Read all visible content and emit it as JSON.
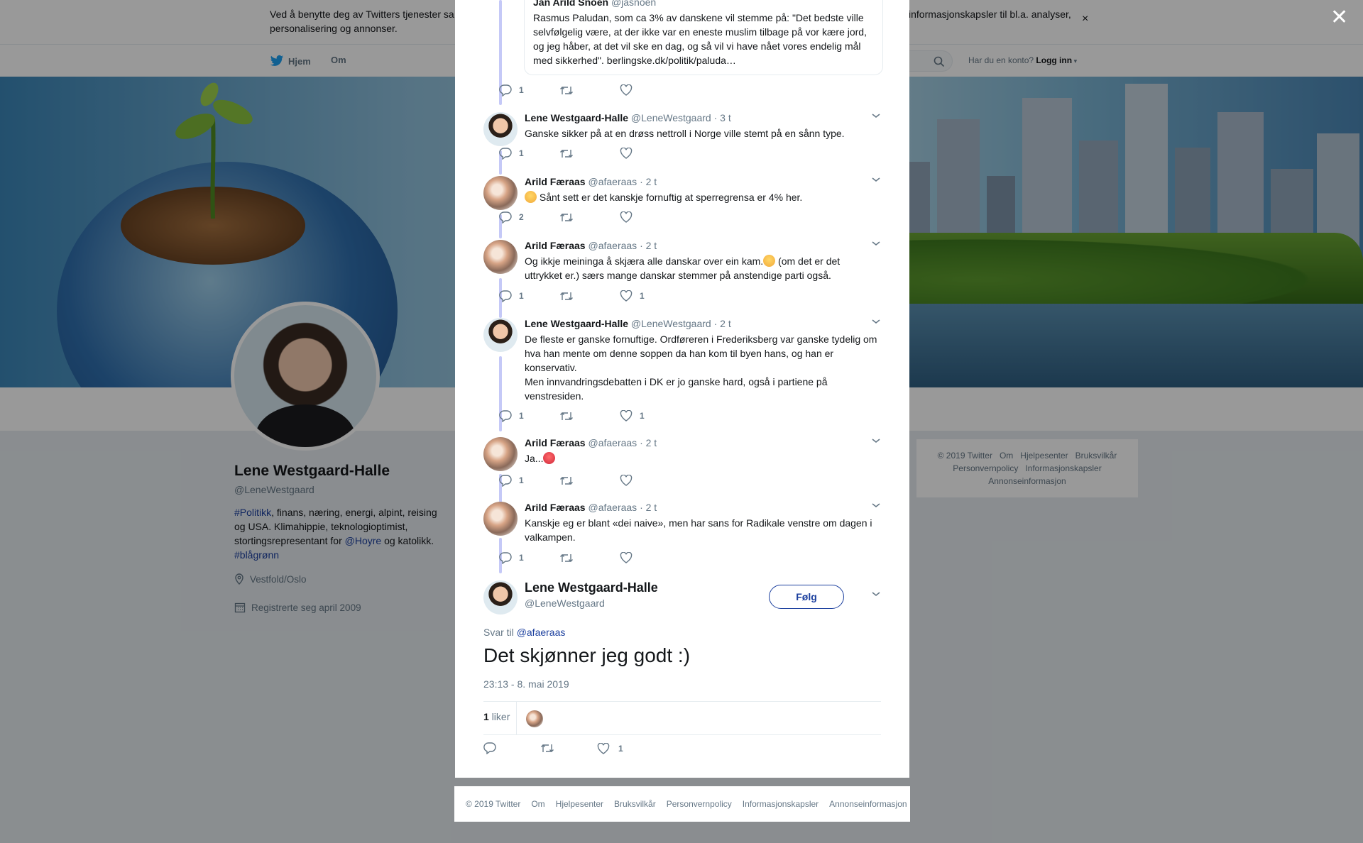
{
  "cookie_banner": {
    "text": "Ved å benytte deg av Twitters tjenester sa",
    "text_right": "informasjonskapsler til bl.a. analyser,",
    "text_line2": "personalisering og annonser.",
    "close": "×"
  },
  "topnav": {
    "home": "Hjem",
    "about": "Om",
    "have_account": "Har du en konto?",
    "login": "Logg inn"
  },
  "profile": {
    "name": "Lene Westgaard-Halle",
    "handle": "@LeneWestgaard",
    "bio_tag1": "#Politikk",
    "bio_text1": ", finans, næring, energi, alpint, reising og USA. Klimahippie, teknologioptimist, stortingsrepresentant for ",
    "bio_mention": "@Hoyre",
    "bio_text2": " og katolikk. ",
    "bio_tag2": "#blågrønn",
    "location": "Vestfold/Oslo",
    "joined": "Registrerte seg april 2009"
  },
  "side_footer": [
    "© 2019 Twitter",
    "Om",
    "Hjelpesenter",
    "Bruksvilkår",
    "Personvernpolicy",
    "Informasjonskapsler",
    "Annonseinformasjon"
  ],
  "modal": {
    "close": "✕",
    "quote": {
      "name": "Jan Arild Snoen",
      "handle": "@jasnoen",
      "text": "Rasmus Paludan, som ca 3% av danskene vil stemme på: \"Det bedste ville selvfølgelig være, at der ikke var en eneste muslim tilbage på vor kære jord, og jeg håber, at det vil ske en dag, og så vil vi have nået vores endelig mål med sikkerhed\". berlingske.dk/politik/paluda…",
      "replies": "1",
      "likes": ""
    },
    "tweets": [
      {
        "name": "Lene Westgaard-Halle",
        "handle": "@LeneWestgaard",
        "time": "· 3 t",
        "text": "Ganske sikker på at en drøss nettroll i Norge ville stemt på en sånn type.",
        "replies": "1",
        "likes": ""
      },
      {
        "name": "Arild Færaas",
        "handle": "@afaeraas",
        "time": "· 2 t",
        "text": "Sånt sett er det kanskje fornuftig at sperregrensa er 4% her.",
        "replies": "2",
        "likes": ""
      },
      {
        "name": "Arild Færaas",
        "handle": "@afaeraas",
        "time": "· 2 t",
        "text_a": "Og ikkje meininga å skjæra alle danskar over ein kam.",
        "text_b": " (om det er det uttrykket er.) særs mange danskar stemmer på anstendige parti også.",
        "replies": "1",
        "likes": "1"
      },
      {
        "name": "Lene Westgaard-Halle",
        "handle": "@LeneWestgaard",
        "time": "· 2 t",
        "text": "De fleste er ganske fornuftige. Ordføreren i Frederiksberg var ganske tydelig om hva han mente om denne soppen da han kom til byen hans, og han er konservativ.",
        "text2": "Men innvandringsdebatten i DK er jo ganske hard, også i partiene på venstresiden.",
        "replies": "1",
        "likes": "1"
      },
      {
        "name": "Arild Færaas",
        "handle": "@afaeraas",
        "time": "· 2 t",
        "text": "Ja...",
        "replies": "1",
        "likes": ""
      },
      {
        "name": "Arild Færaas",
        "handle": "@afaeraas",
        "time": "· 2 t",
        "text": "Kanskje eg er blant «dei naive», men har sans for Radikale venstre om dagen i valkampen.",
        "replies": "1",
        "likes": ""
      }
    ],
    "main": {
      "name": "Lene Westgaard-Halle",
      "handle": "@LeneWestgaard",
      "follow": "Følg",
      "reply_to_label": "Svar til",
      "reply_to": "@afaeraas",
      "text": "Det skjønner jeg godt :)",
      "timestamp": "23:13 - 8. mai 2019",
      "like_count": "1",
      "like_label": "liker",
      "action_likes": "1"
    }
  },
  "bottom_footer": [
    "© 2019 Twitter",
    "Om",
    "Hjelpesenter",
    "Bruksvilkår",
    "Personvernpolicy",
    "Informasjonskapsler",
    "Annonseinformasjon"
  ],
  "colors": {
    "link": "#1b3f9e",
    "thread_line": "#c5c9f7",
    "muted": "#657786",
    "background": "#e6ecf0"
  }
}
